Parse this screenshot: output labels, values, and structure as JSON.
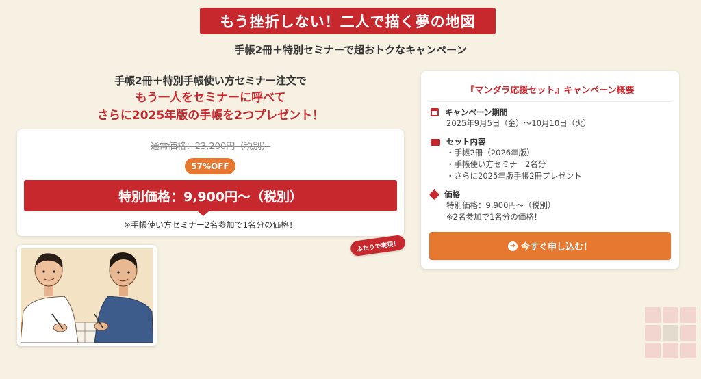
{
  "banner": {
    "title": "もう挫折しない！二人で描く夢の地図"
  },
  "subtitle": "手帳2冊＋特別セミナーで超おトクなキャンペーン",
  "headline": {
    "line1": "手帳2冊＋特別手帳使い方セミナー注文で",
    "line2": "もう一人をセミナーに呼べて",
    "line3": "さらに2025年版の手帳を2つプレゼント！"
  },
  "pricing": {
    "regular": "通常価格：23,200円（税別）",
    "discount_badge": "57%OFF",
    "special": "特別価格：9,900円〜（税別）",
    "note": "※手帳使い方セミナー2名参加で1名分の価格！"
  },
  "sticker": "ふたりで実現！",
  "summary": {
    "title": "『マンダラ応援セット』キャンペーン概要",
    "period": {
      "icon": "calendar-icon",
      "label": "キャンペーン期間",
      "value": "2025年9月5日（金）〜10月10日（火）"
    },
    "set": {
      "icon": "box-icon",
      "label": "セット内容",
      "items": [
        "・手帳2冊（2026年版）",
        "・手帳使い方セミナー2名分",
        "・さらに2025年版手帳2冊プレゼント"
      ]
    },
    "price": {
      "icon": "tag-icon",
      "label": "価格",
      "lines": [
        "特別価格：9,900円〜（税別）",
        "※2名参加で1名分の価格！"
      ]
    },
    "cta": {
      "icon": "arrow-circle-icon",
      "label": "今すぐ申し込む！"
    }
  },
  "colors": {
    "brand_red": "#c7282e",
    "accent_orange": "#e6792f",
    "background": "#f7f1e4"
  }
}
